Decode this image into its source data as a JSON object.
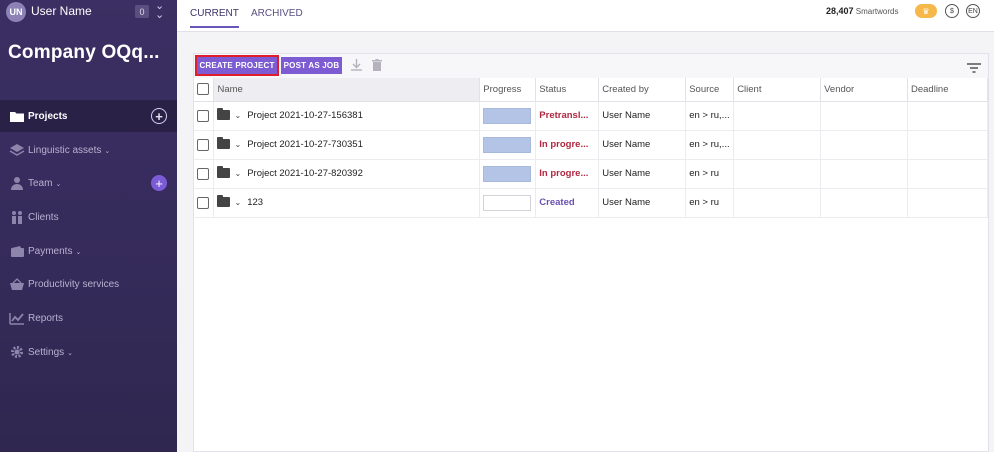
{
  "sidebar": {
    "avatar_initials": "UN",
    "user_name": "User Name",
    "notifications": "0",
    "company": "Company OQq...",
    "items": [
      {
        "label": "Projects",
        "icon": "folder-icon"
      },
      {
        "label": "Linguistic assets",
        "icon": "layers-icon"
      },
      {
        "label": "Team",
        "icon": "person-icon"
      },
      {
        "label": "Clients",
        "icon": "people-icon"
      },
      {
        "label": "Payments",
        "icon": "wallet-icon"
      },
      {
        "label": "Productivity services",
        "icon": "basket-icon"
      },
      {
        "label": "Reports",
        "icon": "chart-icon"
      },
      {
        "label": "Settings",
        "icon": "gear-icon"
      }
    ]
  },
  "header": {
    "tabs": [
      {
        "label": "CURRENT"
      },
      {
        "label": "ARCHIVED"
      }
    ],
    "smartwords_count": "28,407",
    "smartwords_label": "Smartwords",
    "language": "EN"
  },
  "toolbar": {
    "create_label": "CREATE PROJECT",
    "post_label": "POST AS JOB"
  },
  "table": {
    "columns": [
      "Name",
      "Progress",
      "Status",
      "Created by",
      "Source",
      "Client",
      "Vendor",
      "Deadline"
    ],
    "rows": [
      {
        "name": "Project 2021-10-27-156381",
        "progress": "filled",
        "status": "Pretransl...",
        "created_by": "User Name",
        "source": "en > ru,..."
      },
      {
        "name": "Project 2021-10-27-730351",
        "progress": "filled",
        "status": "In progre...",
        "created_by": "User Name",
        "source": "en > ru,..."
      },
      {
        "name": "Project 2021-10-27-820392",
        "progress": "filled",
        "status": "In progre...",
        "created_by": "User Name",
        "source": "en > ru"
      },
      {
        "name": "123",
        "progress": "empty",
        "status": "Created",
        "created_by": "User Name",
        "source": "en > ru"
      }
    ]
  },
  "colors": {
    "sidebar_bg": "#3b2f63",
    "accent": "#7d5bd2",
    "highlight_border": "#e01d2b",
    "status_red": "#b0283f",
    "status_purple": "#6a4fb0"
  }
}
